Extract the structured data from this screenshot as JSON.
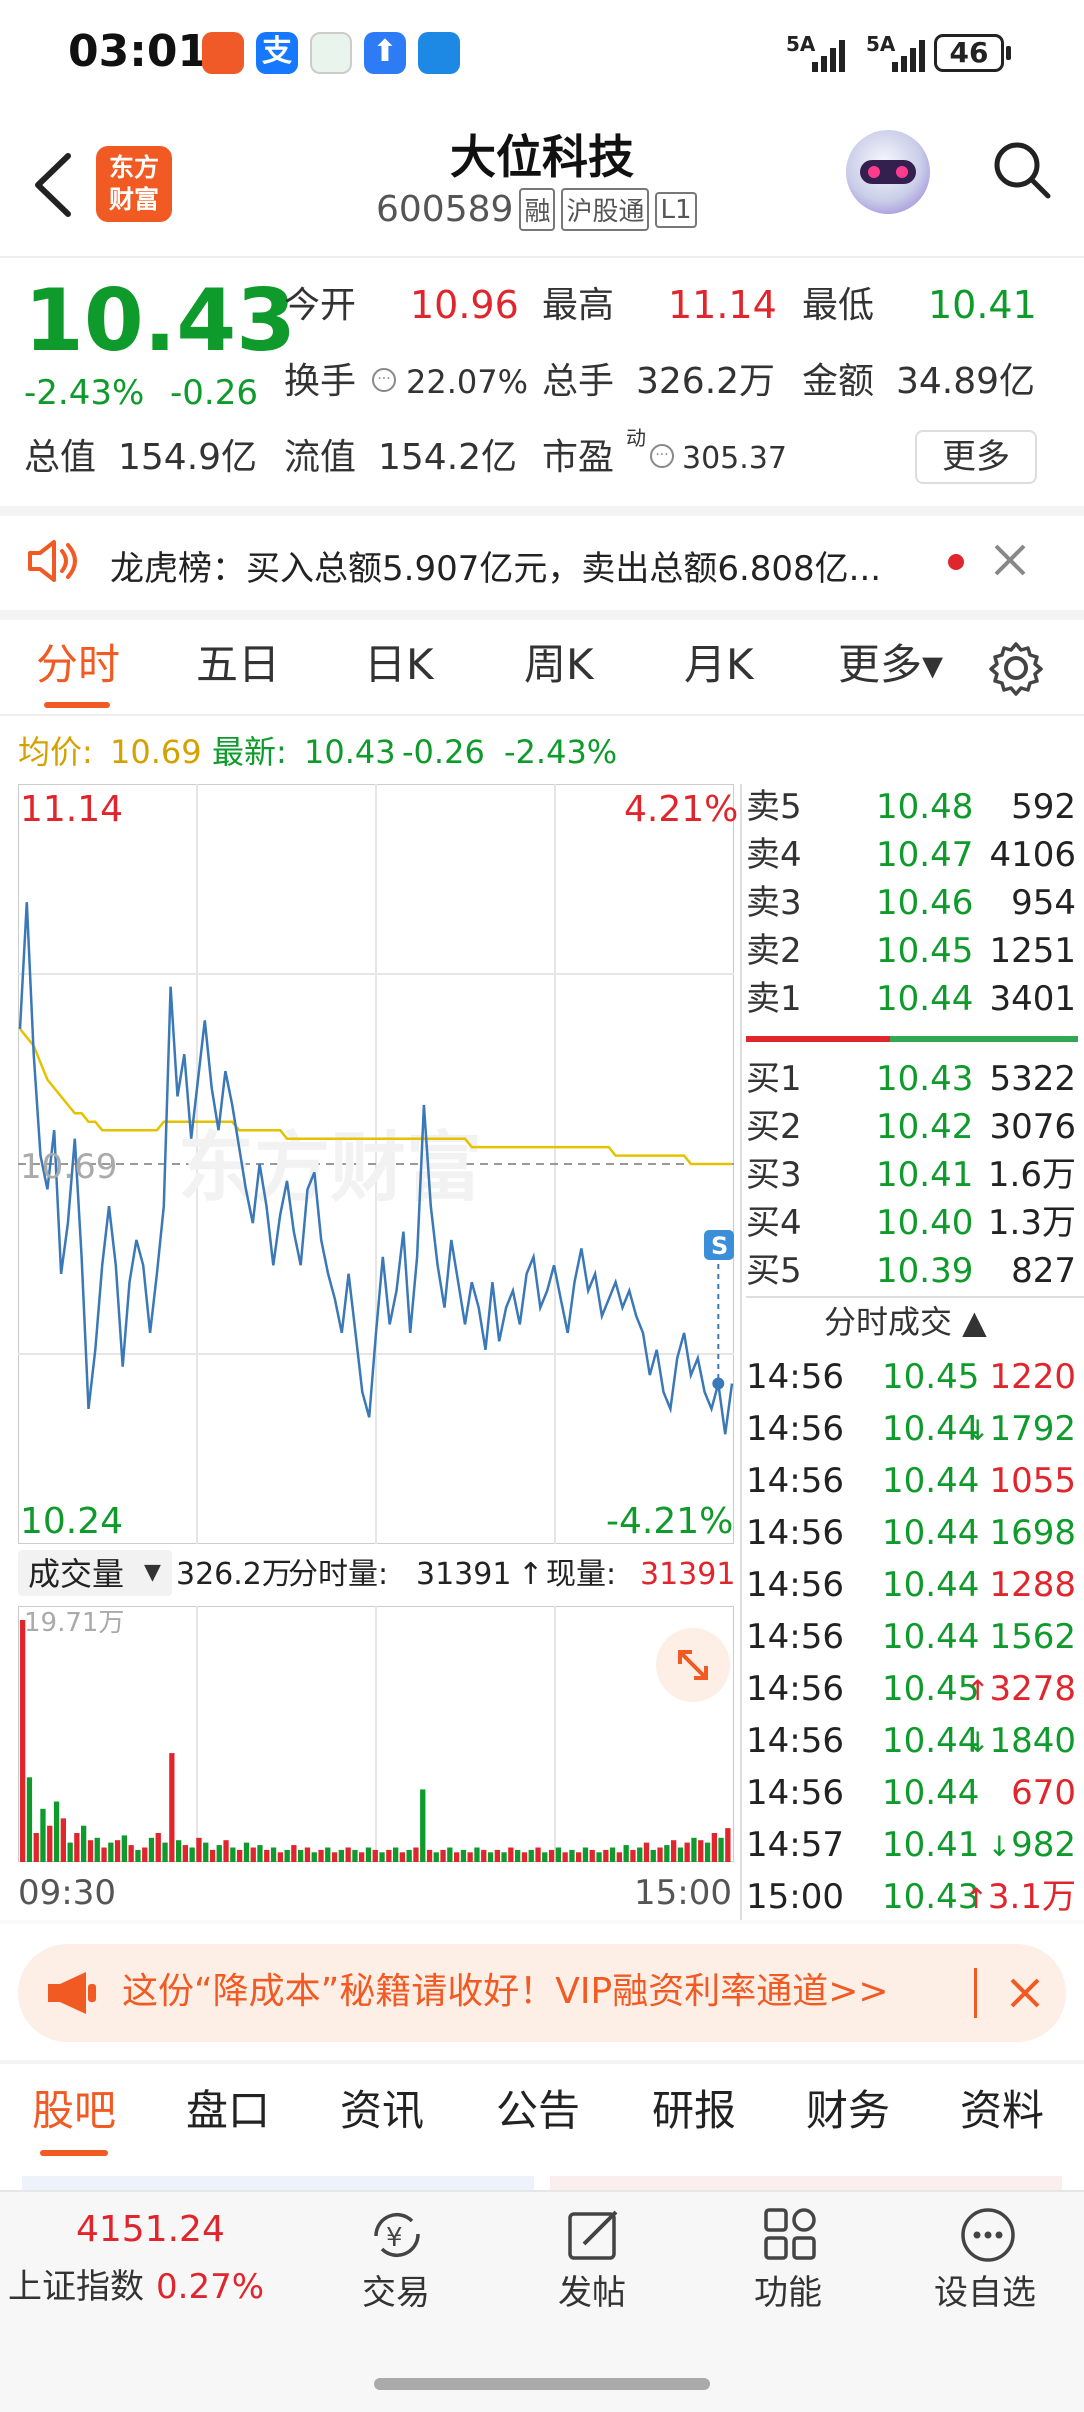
{
  "status_bar": {
    "time": "03:01",
    "signal1": "5A",
    "signal2": "5A",
    "battery": "46"
  },
  "header": {
    "logo_line1": "东方",
    "logo_line2": "财富",
    "stock_name": "大位科技",
    "stock_code": "600589",
    "tags": [
      "融",
      "沪股通",
      "L1"
    ]
  },
  "quote": {
    "price": "10.43",
    "change_pct": "-2.43%",
    "change": "-0.26",
    "open_label": "今开",
    "open": "10.96",
    "high_label": "最高",
    "high": "11.14",
    "low_label": "最低",
    "low": "10.41",
    "turnover_label": "换手",
    "turnover": "22.07%",
    "volume_label": "总手",
    "volume": "326.2万",
    "amount_label": "金额",
    "amount": "34.89亿",
    "mktcap_label": "总值",
    "mktcap": "154.9亿",
    "float_label": "流值",
    "float": "154.2亿",
    "pe_label": "市盈",
    "pe_sup": "动",
    "pe": "305.37",
    "more_button": "更多"
  },
  "notice": {
    "text": "龙虎榜：买入总额5.907亿元，卖出总额6.808亿..."
  },
  "chart_tabs": {
    "items": [
      "分时",
      "五日",
      "日K",
      "周K",
      "月K",
      "更多▾"
    ],
    "active": 0
  },
  "intraday_info": {
    "avg_label": "均价:",
    "avg": "10.69",
    "latest_label": "最新:",
    "latest": "10.43",
    "latest_change": "-0.26",
    "latest_pct": "-2.43%"
  },
  "chart_labels": {
    "top_price": "11.14",
    "top_pct": "4.21%",
    "mid_price": "10.69",
    "bottom_price": "10.24",
    "bottom_pct": "-4.21%",
    "watermark": "东方财富",
    "s_marker": "S"
  },
  "chart_data": {
    "type": "line",
    "title": "",
    "x_range": [
      "09:30",
      "15:00"
    ],
    "ylim": [
      10.24,
      11.14
    ],
    "reference_price": 10.69,
    "series": [
      {
        "name": "价格",
        "color": "#3a78b8",
        "values": [
          10.85,
          11.0,
          10.82,
          10.7,
          10.66,
          10.73,
          10.56,
          10.62,
          10.72,
          10.58,
          10.4,
          10.47,
          10.57,
          10.64,
          10.57,
          10.45,
          10.55,
          10.6,
          10.57,
          10.49,
          10.56,
          10.64,
          10.9,
          10.77,
          10.82,
          10.72,
          10.79,
          10.86,
          10.78,
          10.73,
          10.8,
          10.76,
          10.71,
          10.66,
          10.62,
          10.69,
          10.64,
          10.57,
          10.63,
          10.67,
          10.61,
          10.57,
          10.66,
          10.68,
          10.6,
          10.56,
          10.53,
          10.49,
          10.56,
          10.49,
          10.42,
          10.39,
          10.49,
          10.58,
          10.5,
          10.54,
          10.61,
          10.49,
          10.58,
          10.76,
          10.64,
          10.57,
          10.52,
          10.6,
          10.55,
          10.5,
          10.55,
          10.52,
          10.47,
          10.55,
          10.48,
          10.52,
          10.54,
          10.5,
          10.56,
          10.58,
          10.52,
          10.54,
          10.57,
          10.53,
          10.49,
          10.55,
          10.59,
          10.54,
          10.56,
          10.51,
          10.53,
          10.55,
          10.52,
          10.54,
          10.51,
          10.49,
          10.44,
          10.47,
          10.42,
          10.4,
          10.46,
          10.49,
          10.44,
          10.46,
          10.42,
          10.4,
          10.43,
          10.37,
          10.43
        ]
      },
      {
        "name": "均价",
        "color": "#e5c200",
        "values": [
          10.85,
          10.84,
          10.83,
          10.81,
          10.79,
          10.78,
          10.77,
          10.76,
          10.75,
          10.75,
          10.74,
          10.74,
          10.73,
          10.73,
          10.73,
          10.73,
          10.73,
          10.73,
          10.73,
          10.73,
          10.73,
          10.74,
          10.74,
          10.74,
          10.74,
          10.74,
          10.74,
          10.74,
          10.74,
          10.74,
          10.74,
          10.74,
          10.73,
          10.73,
          10.73,
          10.73,
          10.73,
          10.73,
          10.73,
          10.72,
          10.72,
          10.72,
          10.72,
          10.72,
          10.72,
          10.72,
          10.72,
          10.72,
          10.72,
          10.72,
          10.72,
          10.72,
          10.72,
          10.72,
          10.72,
          10.72,
          10.72,
          10.72,
          10.72,
          10.72,
          10.72,
          10.72,
          10.72,
          10.72,
          10.72,
          10.72,
          10.71,
          10.71,
          10.71,
          10.71,
          10.71,
          10.71,
          10.71,
          10.71,
          10.71,
          10.71,
          10.71,
          10.71,
          10.71,
          10.71,
          10.71,
          10.71,
          10.71,
          10.71,
          10.71,
          10.71,
          10.71,
          10.7,
          10.7,
          10.7,
          10.7,
          10.7,
          10.7,
          10.7,
          10.7,
          10.7,
          10.7,
          10.7,
          10.69,
          10.69,
          10.69,
          10.69,
          10.69,
          10.69,
          10.69
        ]
      }
    ],
    "volume": {
      "max_label": "19.71万",
      "bars": [
        100,
        35,
        12,
        22,
        15,
        25,
        18,
        8,
        12,
        15,
        9,
        10,
        6,
        8,
        9,
        11,
        7,
        5,
        6,
        10,
        12,
        8,
        45,
        9,
        7,
        6,
        10,
        8,
        5,
        7,
        9,
        6,
        5,
        8,
        6,
        7,
        5,
        6,
        4,
        5,
        7,
        5,
        6,
        4,
        5,
        6,
        4,
        5,
        6,
        5,
        4,
        6,
        5,
        4,
        5,
        6,
        4,
        5,
        6,
        30,
        5,
        4,
        5,
        6,
        4,
        5,
        4,
        6,
        5,
        4,
        5,
        4,
        6,
        5,
        4,
        5,
        6,
        4,
        5,
        6,
        4,
        5,
        4,
        6,
        5,
        4,
        5,
        6,
        4,
        7,
        5,
        6,
        8,
        5,
        6,
        7,
        9,
        6,
        8,
        10,
        9,
        8,
        12,
        10,
        14
      ]
    }
  },
  "volume_info": {
    "label": "成交量",
    "total": "326.2万",
    "fen_label": "分时量:",
    "fen_value": "31391",
    "arrow": "↑",
    "now_label": "现量:",
    "now_value": "31391"
  },
  "time_axis": {
    "start": "09:30",
    "end": "15:00"
  },
  "order_book": {
    "asks": [
      {
        "label": "卖5",
        "price": "10.48",
        "vol": "592"
      },
      {
        "label": "卖4",
        "price": "10.47",
        "vol": "4106"
      },
      {
        "label": "卖3",
        "price": "10.46",
        "vol": "954"
      },
      {
        "label": "卖2",
        "price": "10.45",
        "vol": "1251"
      },
      {
        "label": "卖1",
        "price": "10.44",
        "vol": "3401"
      }
    ],
    "bids": [
      {
        "label": "买1",
        "price": "10.43",
        "vol": "5322"
      },
      {
        "label": "买2",
        "price": "10.42",
        "vol": "3076"
      },
      {
        "label": "买3",
        "price": "10.41",
        "vol": "1.6万"
      },
      {
        "label": "买4",
        "price": "10.40",
        "vol": "1.3万"
      },
      {
        "label": "买5",
        "price": "10.39",
        "vol": "827"
      }
    ]
  },
  "ticks": {
    "title": "分时成交 ▲",
    "rows": [
      {
        "time": "14:56",
        "price": "10.45",
        "arrow": "",
        "vol": "1220",
        "color": "red"
      },
      {
        "time": "14:56",
        "price": "10.44",
        "arrow": "↓",
        "vol": "1792",
        "color": "green"
      },
      {
        "time": "14:56",
        "price": "10.44",
        "arrow": "",
        "vol": "1055",
        "color": "red"
      },
      {
        "time": "14:56",
        "price": "10.44",
        "arrow": "",
        "vol": "1698",
        "color": "green"
      },
      {
        "time": "14:56",
        "price": "10.44",
        "arrow": "",
        "vol": "1288",
        "color": "red"
      },
      {
        "time": "14:56",
        "price": "10.44",
        "arrow": "",
        "vol": "1562",
        "color": "green"
      },
      {
        "time": "14:56",
        "price": "10.45",
        "arrow": "↑",
        "vol": "3278",
        "color": "red"
      },
      {
        "time": "14:56",
        "price": "10.44",
        "arrow": "↓",
        "vol": "1840",
        "color": "green"
      },
      {
        "time": "14:56",
        "price": "10.44",
        "arrow": "",
        "vol": "670",
        "color": "red"
      },
      {
        "time": "14:57",
        "price": "10.41",
        "arrow": "↓",
        "vol": "982",
        "color": "green"
      },
      {
        "time": "15:00",
        "price": "10.43",
        "arrow": "↑",
        "vol": "3.1万",
        "color": "red"
      }
    ]
  },
  "promo": {
    "text": "这份“降成本”秘籍请收好！VIP融资利率通道>>"
  },
  "bottom_tabs": {
    "items": [
      "股吧",
      "盘口",
      "资讯",
      "公告",
      "研报",
      "财务",
      "资料"
    ],
    "active": 0
  },
  "index": {
    "value": "4151.24",
    "name": "上证指数",
    "pct": "0.27%"
  },
  "bottom_nav": {
    "trade": "交易",
    "post": "发帖",
    "func": "功能",
    "watch": "设自选"
  },
  "colors": {
    "up": "#e0262c",
    "down": "#0f9b2c",
    "price_line": "#3a78b8",
    "avg_line": "#e5c200",
    "accent": "#f15a22"
  }
}
